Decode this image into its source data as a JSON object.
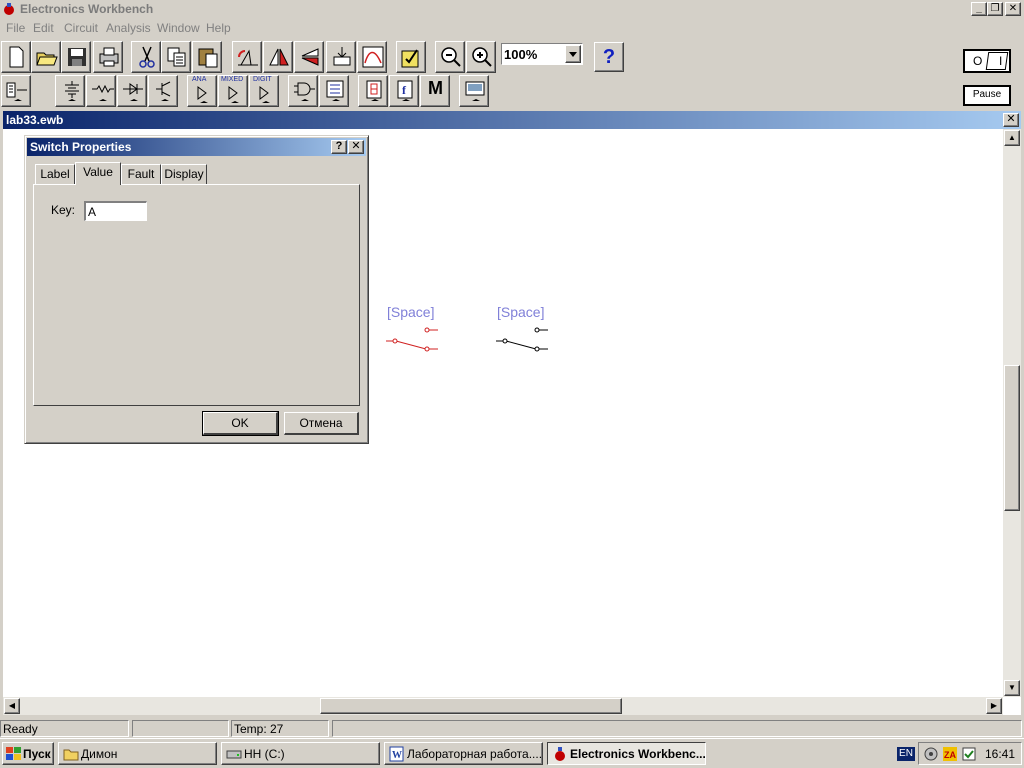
{
  "app": {
    "title": "Electronics Workbench"
  },
  "menu": [
    "File",
    "Edit",
    "Circuit",
    "Analysis",
    "Window",
    "Help"
  ],
  "toolbar": {
    "zoom_value": "100%",
    "help_label": "?",
    "pause_label": "Pause",
    "power_off": "O",
    "power_on": "I"
  },
  "parts_bins": {
    "analog_ic": "ANA",
    "mixed_ic": "MIXED",
    "digital_ic": "DIGIT",
    "misc": "M"
  },
  "document": {
    "title": "lab33.ewb"
  },
  "switches": [
    {
      "label": "[Space]",
      "color": "#d02020"
    },
    {
      "label": "[Space]",
      "color": "#000000"
    }
  ],
  "dialog": {
    "title": "Switch Properties",
    "help": "?",
    "close": "✕",
    "tabs": [
      "Label",
      "Value",
      "Fault",
      "Display"
    ],
    "active_tab": "Value",
    "key_label": "Key:",
    "key_value": "A",
    "ok": "OK",
    "cancel": "Отмена"
  },
  "status": {
    "ready": "Ready",
    "temp": "Temp:  27"
  },
  "taskbar": {
    "start": "Пуск",
    "tasks": [
      "Димон",
      "HH (C:)",
      "Лабораторная работа....",
      "Electronics Workbenc..."
    ],
    "lang": "EN",
    "time": "16:41"
  }
}
